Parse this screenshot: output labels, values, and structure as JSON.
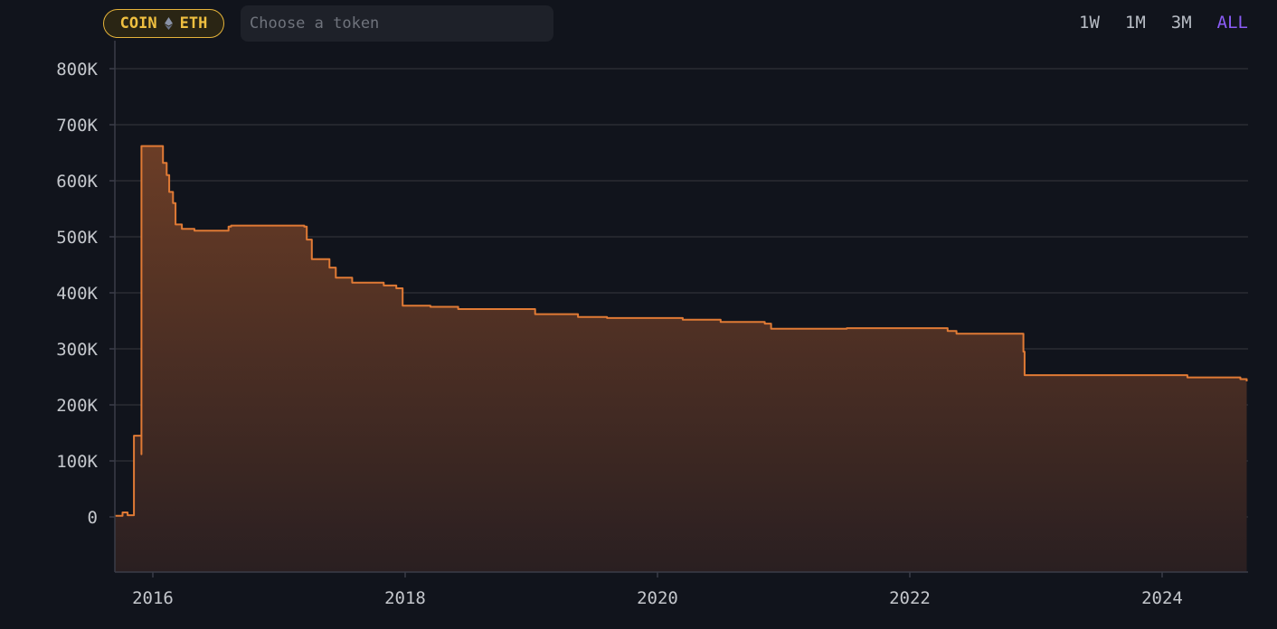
{
  "toolbar": {
    "coin_label": "COIN",
    "eth_label": "ETH",
    "token_placeholder": "Choose a token",
    "ranges": [
      "1W",
      "1M",
      "3M",
      "ALL"
    ],
    "active_range": "ALL"
  },
  "colors": {
    "background": "#11141c",
    "line": "#e07a35",
    "accent": "#8b5cf6",
    "chip": "#e6b43a"
  },
  "chart_data": {
    "type": "area",
    "title": "",
    "xlabel": "",
    "ylabel": "",
    "step": true,
    "grid": true,
    "xlim": [
      2015.7,
      2024.67
    ],
    "ylim": [
      -100000,
      800000
    ],
    "x_ticks": [
      2016,
      2018,
      2020,
      2022,
      2024
    ],
    "x_tick_labels": [
      "2016",
      "2018",
      "2020",
      "2022",
      "2024"
    ],
    "y_ticks": [
      0,
      100000,
      200000,
      300000,
      400000,
      500000,
      600000,
      700000,
      800000
    ],
    "y_tick_labels": [
      "0",
      "100K",
      "200K",
      "300K",
      "400K",
      "500K",
      "600K",
      "700K",
      "800K"
    ],
    "series": [
      {
        "x": [
          2015.7,
          2015.76,
          2015.8,
          2015.85,
          2015.86,
          2015.91,
          2015.91,
          2016.06,
          2016.08,
          2016.11,
          2016.13,
          2016.16,
          2016.18,
          2016.23,
          2016.33,
          2016.43,
          2016.6,
          2016.62,
          2017.2,
          2017.22,
          2017.26,
          2017.4,
          2017.45,
          2017.58,
          2017.83,
          2017.93,
          2017.98,
          2018.2,
          2018.42,
          2018.97,
          2019.03,
          2019.37,
          2019.6,
          2020.2,
          2020.5,
          2020.85,
          2020.9,
          2021.5,
          2022.3,
          2022.37,
          2022.9,
          2022.91,
          2024.2,
          2024.62,
          2024.67
        ],
        "y": [
          2000,
          8000,
          3000,
          145000,
          145000,
          112000,
          662000,
          662000,
          632000,
          610000,
          580000,
          560000,
          522000,
          514000,
          511000,
          511000,
          518000,
          520000,
          518000,
          495000,
          460000,
          445000,
          427000,
          418000,
          413000,
          408000,
          377000,
          375000,
          371000,
          371000,
          362000,
          357000,
          355000,
          352000,
          348000,
          345000,
          336000,
          337000,
          332000,
          327000,
          295000,
          253000,
          249000,
          246000,
          242000
        ]
      }
    ]
  }
}
